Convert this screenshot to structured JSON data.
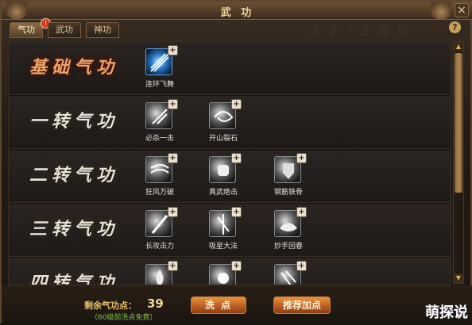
{
  "window": {
    "title": "武 功"
  },
  "tabs": [
    {
      "label": "气功",
      "active": true,
      "badge": "!"
    },
    {
      "label": "武功",
      "active": false
    },
    {
      "label": "神功",
      "active": false
    }
  ],
  "help_label": "?",
  "close_label": "×",
  "watermark": "3 7 - 1 8 6",
  "rows": [
    {
      "title": "基础气功",
      "highlight": true,
      "skills": [
        {
          "name": "连环飞舞",
          "icon": "blue-spiral-icon"
        }
      ]
    },
    {
      "title": "一转气功",
      "highlight": false,
      "skills": [
        {
          "name": "必杀一击",
          "icon": "strike-icon"
        },
        {
          "name": "开山裂石",
          "icon": "swirl-icon"
        }
      ]
    },
    {
      "title": "二转气功",
      "highlight": false,
      "skills": [
        {
          "name": "狂风万破",
          "icon": "wind-icon"
        },
        {
          "name": "真武绝击",
          "icon": "fist-icon"
        },
        {
          "name": "钢筋铁骨",
          "icon": "armor-icon"
        }
      ]
    },
    {
      "title": "三转气功",
      "highlight": false,
      "skills": [
        {
          "name": "长攻击力",
          "icon": "slash-icon"
        },
        {
          "name": "吸星大法",
          "icon": "light-icon"
        },
        {
          "name": "妙手回春",
          "icon": "lotus-icon"
        }
      ]
    },
    {
      "title": "四转气功",
      "highlight": false,
      "skills": [
        {
          "name": "",
          "icon": "flame-icon"
        },
        {
          "name": "",
          "icon": "burst-icon"
        },
        {
          "name": "",
          "icon": "claw-icon"
        }
      ]
    }
  ],
  "footer": {
    "points_label": "剩余气功点：",
    "points_value": "39",
    "reset_note": "（60级前洗点免费）",
    "reset_button": "洗 点",
    "recommend_button": "推荐加点"
  },
  "brand": "萌探说",
  "colors": {
    "accent": "#e8943e",
    "title_gold": "#f0d7a0",
    "highlight_red": "#e9a36a"
  }
}
